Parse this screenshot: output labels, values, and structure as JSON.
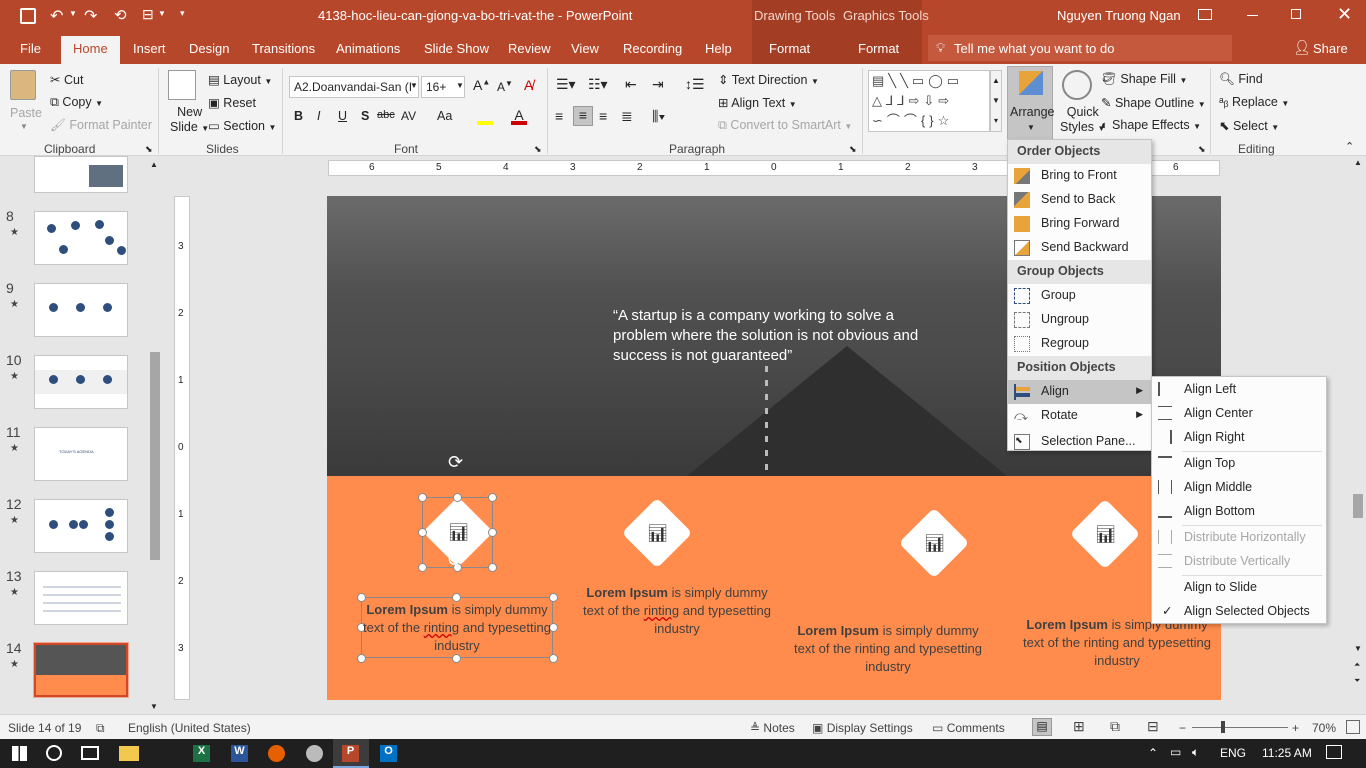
{
  "titlebar": {
    "filename": "4138-hoc-lieu-can-giong-va-bo-tri-vat-the",
    "separator": "-",
    "app": "PowerPoint",
    "context_drawing": "Drawing Tools",
    "context_graphics": "Graphics Tools",
    "user": "Nguyen Truong Ngan"
  },
  "tabs": [
    "File",
    "Home",
    "Insert",
    "Design",
    "Transitions",
    "Animations",
    "Slide Show",
    "Review",
    "View",
    "Recording",
    "Help",
    "Format",
    "Format"
  ],
  "tellme": "Tell me what you want to do",
  "share": "Share",
  "ribbon": {
    "clipboard": {
      "paste": "Paste",
      "cut": "Cut",
      "copy": "Copy",
      "format_painter": "Format Painter",
      "label": "Clipboard"
    },
    "slides": {
      "new_slide_1": "New",
      "new_slide_2": "Slide",
      "layout": "Layout",
      "reset": "Reset",
      "section": "Section",
      "label": "Slides"
    },
    "font": {
      "name": "A2.Doanvandai-San (I",
      "size": "16+",
      "label": "Font",
      "b": "B",
      "i": "I",
      "u": "U",
      "s": "S",
      "abc": "abc",
      "av": "AV",
      "aa": "Aa"
    },
    "paragraph": {
      "text_direction": "Text Direction",
      "align_text": "Align Text",
      "convert": "Convert to SmartArt",
      "label": "Paragraph"
    },
    "drawing": {
      "arrange": "Arrange",
      "quick_1": "Quick",
      "quick_2": "Styles",
      "shape_fill": "Shape Fill",
      "shape_outline": "Shape Outline",
      "shape_effects": "Shape Effects",
      "label": "Drawing"
    },
    "editing": {
      "find": "Find",
      "replace": "Replace",
      "select": "Select",
      "label": "Editing"
    }
  },
  "ruler_ticks": [
    "6",
    "5",
    "4",
    "3",
    "2",
    "1",
    "0",
    "1",
    "2",
    "3",
    "4",
    "5",
    "6"
  ],
  "vruler_ticks": [
    "3",
    "2",
    "1",
    "0",
    "1",
    "2",
    "3"
  ],
  "thumbnails": [
    {
      "num": "8",
      "star": "★"
    },
    {
      "num": "9",
      "star": "★"
    },
    {
      "num": "10",
      "star": "★"
    },
    {
      "num": "11",
      "star": "★",
      "text": "TODAY'S AGENDA"
    },
    {
      "num": "12",
      "star": "★"
    },
    {
      "num": "13",
      "star": "★"
    },
    {
      "num": "14",
      "star": "★"
    }
  ],
  "slide": {
    "quote": "“A startup is a company working to solve a problem where the solution is not obvious and success is not guaranteed”",
    "captions": [
      {
        "bold": "Lorem Ipsum",
        "rest1": " is simply dummy text of the ",
        "ul": "rinting",
        "rest2": " and typesetting industry"
      },
      {
        "bold": "Lorem Ipsum",
        "rest1": " is simply dummy text of the ",
        "ul": "rinting",
        "rest2": " and typesetting industry"
      },
      {
        "bold": "Lorem Ipsum",
        "rest1": " is simply dummy text of the rinting and typesetting industry",
        "ul": "",
        "rest2": ""
      },
      {
        "bold": "Lorem Ipsum",
        "rest1": " is simply dummy text of the rinting and typesetting industry",
        "ul": "",
        "rest2": ""
      }
    ]
  },
  "arrange_menu": {
    "h_order": "Order Objects",
    "bring_front": "Bring to Front",
    "send_back": "Send to Back",
    "bring_forward": "Bring Forward",
    "send_backward": "Send Backward",
    "h_group": "Group Objects",
    "group": "Group",
    "ungroup": "Ungroup",
    "regroup": "Regroup",
    "h_position": "Position Objects",
    "align": "Align",
    "rotate": "Rotate",
    "selection_pane": "Selection Pane..."
  },
  "align_menu": {
    "left": "Align Left",
    "center": "Align Center",
    "right": "Align Right",
    "top": "Align Top",
    "middle": "Align Middle",
    "bottom": "Align Bottom",
    "dist_h": "Distribute Horizontally",
    "dist_v": "Distribute Vertically",
    "to_slide": "Align to Slide",
    "selected": "Align Selected Objects",
    "check": "✓"
  },
  "status": {
    "slide": "Slide 14 of 19",
    "lang": "English (United States)",
    "notes": "Notes",
    "display": "Display Settings",
    "comments": "Comments",
    "zoom": "70%"
  },
  "taskbar": {
    "lang": "ENG",
    "time": "11:25 AM"
  },
  "colors": {
    "accent": "#b7472a",
    "orange": "#ff8c4c",
    "menu_hl": "#c5c5c5"
  }
}
